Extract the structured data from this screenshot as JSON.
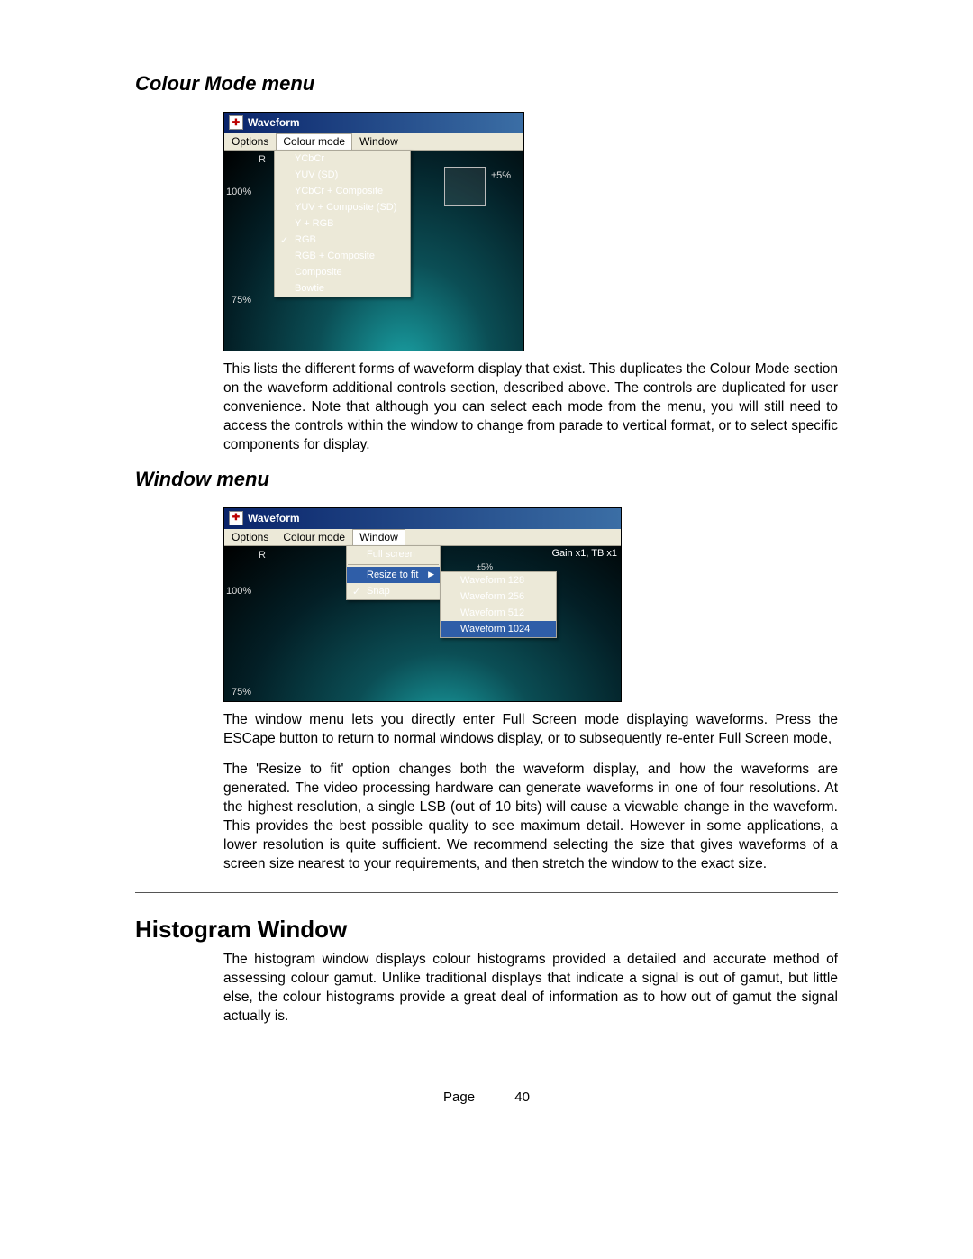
{
  "headings": {
    "colour_mode": "Colour Mode menu",
    "window_menu": "Window menu",
    "histogram": "Histogram Window"
  },
  "screenshot1": {
    "title": "Waveform",
    "menubar": {
      "options": "Options",
      "colour_mode": "Colour mode",
      "window": "Window"
    },
    "dropdown": {
      "ycbcr": "YCbCr",
      "yuv_sd": "YUV (SD)",
      "ycbcr_comp": "YCbCr + Composite",
      "yuv_comp_sd": "YUV + Composite (SD)",
      "y_rgb": "Y + RGB",
      "rgb": "RGB",
      "rgb_comp": "RGB + Composite",
      "composite": "Composite",
      "bowtie": "Bowtie"
    },
    "labels": {
      "r": "R",
      "p100": "100%",
      "p75": "75%",
      "pm5": "±5%"
    }
  },
  "para1": "This lists the different forms of waveform display that exist. This duplicates the Colour Mode section on the waveform additional controls section, described above.  The controls are duplicated for user convenience.  Note that although you can select each mode from the menu, you will still need to access the controls within the window to change from parade to vertical format, or to select specific components for display.",
  "screenshot2": {
    "title": "Waveform",
    "menubar": {
      "options": "Options",
      "colour_mode": "Colour mode",
      "window": "Window"
    },
    "dropdown": {
      "full_screen": "Full screen",
      "resize": "Resize to fit",
      "snap": "Snap"
    },
    "submenu": {
      "w128": "Waveform 128",
      "w256": "Waveform 256",
      "w512": "Waveform 512",
      "w1024": "Waveform 1024"
    },
    "labels": {
      "r": "R",
      "p100": "100%",
      "p75": "75%",
      "pm5": "±5%",
      "gain": "Gain x1, TB x1"
    }
  },
  "para2": "The window menu lets you directly enter Full Screen mode displaying waveforms.  Press the ESCape button to return to normal windows display, or to subsequently re-enter Full Screen mode,",
  "para3": "The 'Resize to fit' option changes both the waveform display, and how the waveforms are generated.  The video processing hardware can generate waveforms in one of four resolutions.  At the highest resolution, a single LSB (out of 10 bits) will cause a viewable change in the waveform.  This provides the best possible quality to see maximum detail.  However in some applications, a lower resolution is quite sufficient.  We recommend selecting the size that gives waveforms of a screen size nearest to your requirements, and then stretch the window to the exact size.",
  "para4": "The histogram window displays colour histograms provided a detailed and accurate method of assessing colour gamut.  Unlike traditional displays that indicate a signal is out of gamut, but little else, the colour histograms provide a great deal of information as to how out of gamut the signal actually is.",
  "footer": {
    "label": "Page",
    "num": "40"
  }
}
